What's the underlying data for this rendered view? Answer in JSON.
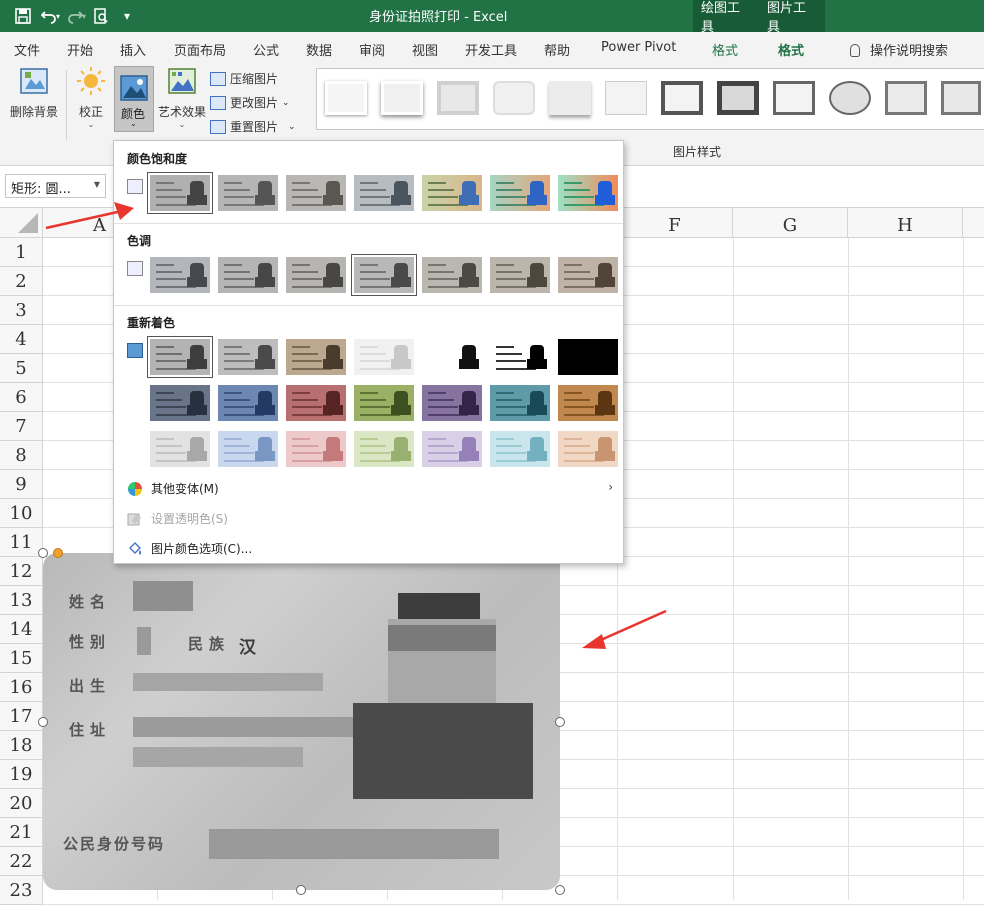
{
  "titlebar": {
    "title": "身份证拍照打印  -  Excel",
    "context_tabs": [
      "绘图工具",
      "图片工具"
    ],
    "qat": {
      "save": "save-icon",
      "undo": "undo-icon",
      "redo": "redo-icon",
      "preview": "print-preview-icon"
    }
  },
  "tabs": {
    "items": [
      "文件",
      "开始",
      "插入",
      "页面布局",
      "公式",
      "数据",
      "审阅",
      "视图",
      "开发工具",
      "帮助",
      "Power Pivot"
    ],
    "context_format1": "格式",
    "context_format2": "格式",
    "search": "操作说明搜索"
  },
  "ribbon": {
    "remove_bg": "删除背景",
    "corrections": "校正",
    "color": "颜色",
    "artistic": "艺术效果",
    "compress": "压缩图片",
    "change": "更改图片",
    "reset": "重置图片",
    "styles_group": "图片样式"
  },
  "formula_bar": {
    "name_box": "矩形: 圆..."
  },
  "grid": {
    "columns": [
      "A",
      "F",
      "G",
      "H"
    ],
    "rows": [
      "1",
      "2",
      "3",
      "4",
      "5",
      "6",
      "7",
      "8",
      "9",
      "10",
      "11",
      "12",
      "13",
      "14",
      "15",
      "16",
      "17",
      "18",
      "19",
      "20",
      "21",
      "22",
      "23"
    ]
  },
  "card": {
    "labels": {
      "name": "姓名",
      "gender": "性别",
      "ethnic": "民族",
      "birth": "出生",
      "address": "住址",
      "id": "公民身份号码"
    },
    "ethnic_value": "汉"
  },
  "color_menu": {
    "saturation_title": "颜色饱和度",
    "tone_title": "色调",
    "recolor_title": "重新着色",
    "more_variants": "其他变体(M)",
    "set_transparent": "设置透明色(S)",
    "color_options": "图片颜色选项(C)..."
  },
  "colors": {
    "excel_green": "#217346",
    "context_dark": "#185c37",
    "arrow_red": "#e8352e"
  }
}
